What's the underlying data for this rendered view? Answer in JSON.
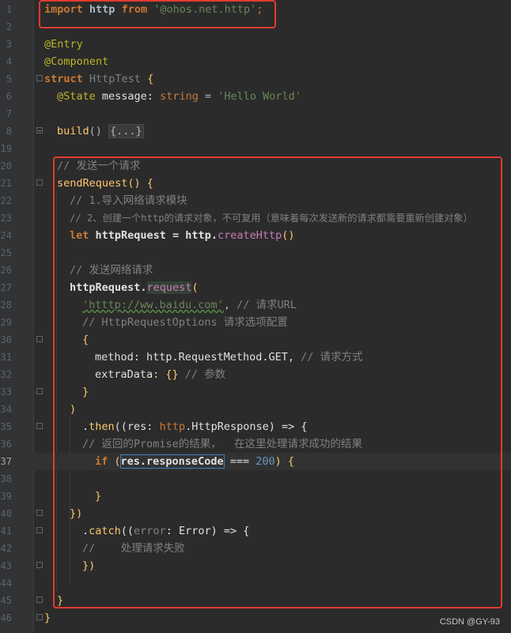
{
  "line_numbers": [
    "1",
    "2",
    "3",
    "4",
    "5",
    "6",
    "7",
    "8",
    "19",
    "20",
    "21",
    "22",
    "23",
    "24",
    "25",
    "26",
    "27",
    "28",
    "29",
    "30",
    "31",
    "32",
    "33",
    "34",
    "35",
    "36",
    "37",
    "38",
    "39",
    "40",
    "41",
    "42",
    "43",
    "44",
    "45",
    "46"
  ],
  "code": {
    "l1": [
      "import",
      " http ",
      "from",
      " ",
      "'@ohos.net.http'",
      ";"
    ],
    "l3": "@Entry",
    "l4": "@Component",
    "l5": [
      "struct",
      " ",
      "HttpTest",
      " {"
    ],
    "l6": [
      "@State",
      " message: ",
      "string",
      " = ",
      "'Hello World'"
    ],
    "l8": [
      "build",
      "() ",
      "{...}"
    ],
    "l20": "// 发送一个请求",
    "l21": [
      "sendRequest",
      "() {"
    ],
    "l22": "// 1.导入网络请求模块",
    "l23": "// 2、创建一个http的请求对象，不可复用（意味着每次发送新的请求都需要重新创建对象）",
    "l24": [
      "let",
      " httpRequest = http.",
      "createHttp",
      "()"
    ],
    "l26": "// 发送网络请求",
    "l27": [
      "httpRequest.",
      "request",
      "("
    ],
    "l28": [
      "'htttp://ww.baidu.com'",
      ", ",
      "// 请求URL"
    ],
    "l29": "// HttpRequestOptions 请求选项配置",
    "l30": "{",
    "l31": [
      "method",
      ": http.RequestMethod.GET, ",
      "// 请求方式"
    ],
    "l32": [
      "extraData",
      ": {} ",
      "// 参数"
    ],
    "l33": "}",
    "l34": ")",
    "l35": [
      ".",
      "then",
      "((res: ",
      "http",
      ".HttpResponse) => {"
    ],
    "l36": "// 返回的Promise的结果，  在这里处理请求成功的结果",
    "l37": [
      "if",
      " (",
      "res.responseCode",
      " === ",
      "200",
      ") {"
    ],
    "l39": "}",
    "l40": "})",
    "l41": [
      ".",
      "catch",
      "((",
      "error",
      ": Error) => {"
    ],
    "l42": "//    处理请求失败",
    "l43": "})",
    "l45": "}",
    "l46": "}"
  },
  "watermark": "CSDN @GY-93",
  "colors": {
    "annotation_box": "#e23b2e",
    "background": "#2b2b2b"
  }
}
